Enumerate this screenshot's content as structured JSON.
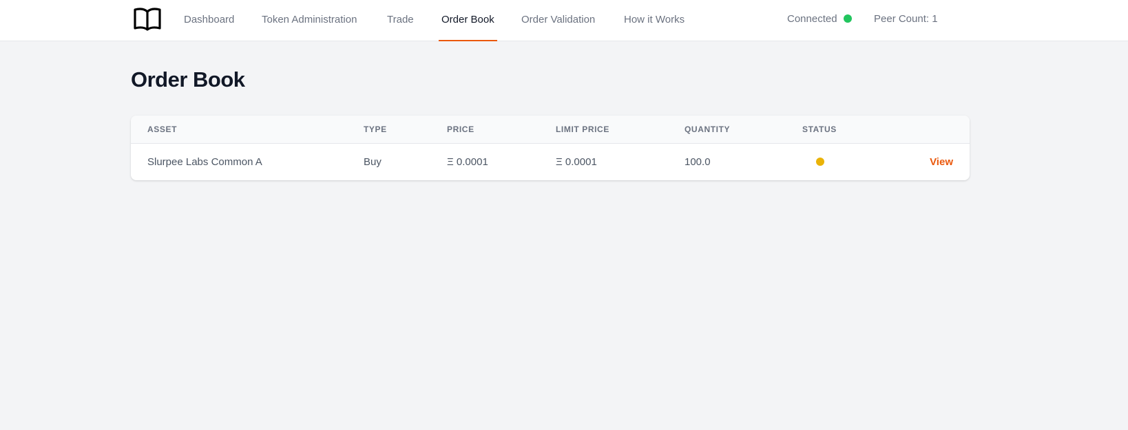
{
  "nav": {
    "items": [
      {
        "label": "Dashboard"
      },
      {
        "label": "Token Administration"
      },
      {
        "label": "Trade"
      },
      {
        "label": "Order Book",
        "active": true
      },
      {
        "label": "Order Validation"
      },
      {
        "label": "How it Works"
      }
    ]
  },
  "header": {
    "connection_status": "Connected",
    "peer_count": "Peer Count: 1"
  },
  "page": {
    "title": "Order Book"
  },
  "table": {
    "columns": [
      "ASSET",
      "TYPE",
      "PRICE",
      "LIMIT PRICE",
      "QUANTITY",
      "STATUS"
    ],
    "rows": [
      {
        "asset": "Slurpee Labs Common A",
        "type": "Buy",
        "price": "Ξ 0.0001",
        "limit_price": "Ξ 0.0001",
        "quantity": "100.0",
        "status_color": "#eab308",
        "action": "View"
      }
    ]
  },
  "colors": {
    "accent": "#ea580c",
    "connected": "#22c55e",
    "pending": "#eab308"
  },
  "icons": {
    "logo": "open-book-icon"
  }
}
